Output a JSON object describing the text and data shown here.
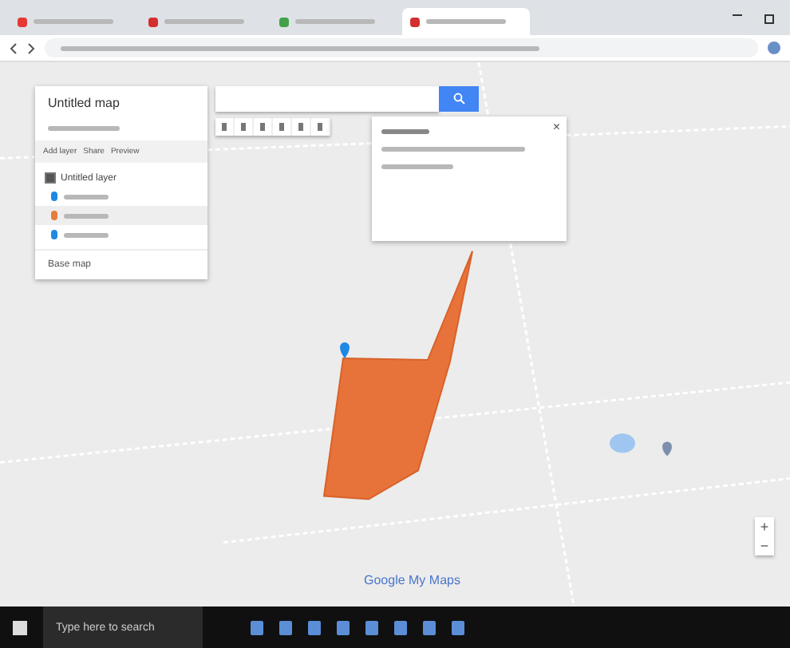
{
  "browser": {
    "tabs": [
      {
        "color": "#e53935",
        "selected": false
      },
      {
        "color": "#d32f2f",
        "selected": false
      },
      {
        "color": "#43a047",
        "selected": false
      },
      {
        "color": "#d32f2f",
        "selected": true
      }
    ]
  },
  "panel": {
    "title": "Untitled map",
    "actions": [
      "Add layer",
      "Share",
      "Preview"
    ],
    "layer": {
      "name": "Untitled layer",
      "checked": true,
      "items": [
        {
          "color": "#1e88e5",
          "selected": false
        },
        {
          "color": "#e67c3a",
          "selected": true
        },
        {
          "color": "#1e88e5",
          "selected": false
        }
      ]
    },
    "base_map": "Base map"
  },
  "popup": {
    "close": "×"
  },
  "zoom": {
    "plus": "+",
    "minus": "−"
  },
  "logo": "Google My Maps",
  "taskbar": {
    "search": {
      "placeholder": "Type here to search"
    }
  }
}
